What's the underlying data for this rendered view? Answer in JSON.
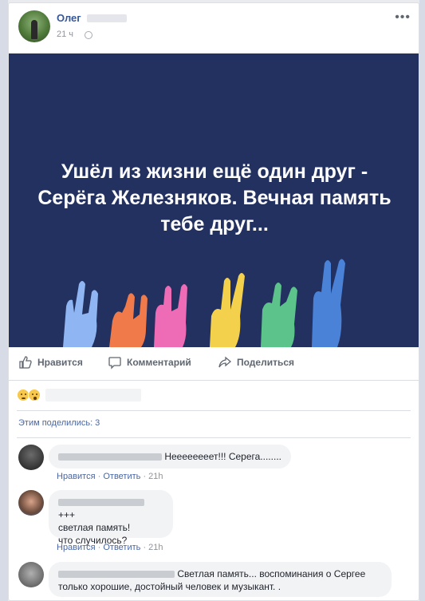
{
  "post": {
    "author": "Олег",
    "time": "21 ч",
    "banner_text": "Ушёл из жизни ещё один друг - Серёга Железняков. Вечная память тебе друг...",
    "banner_bg": "#233160"
  },
  "actions": {
    "like": "Нравится",
    "comment": "Комментарий",
    "share": "Поделиться"
  },
  "stats": {
    "shares": "Этим поделились: 3"
  },
  "comments": [
    {
      "text": "Неееееееет!!! Серега........",
      "like": "Нравится",
      "reply": "Ответить",
      "time": "21h"
    },
    {
      "text_line1": "+++",
      "text_line2": "светлая память!",
      "text_line3": "что случилось?",
      "like": "Нравится",
      "reply": "Ответить",
      "time": "21h"
    },
    {
      "text_line1": "Светлая память... воспоминания о Сергее",
      "text_line2": "только хорошие, достойный человек и музыкант. ."
    }
  ]
}
